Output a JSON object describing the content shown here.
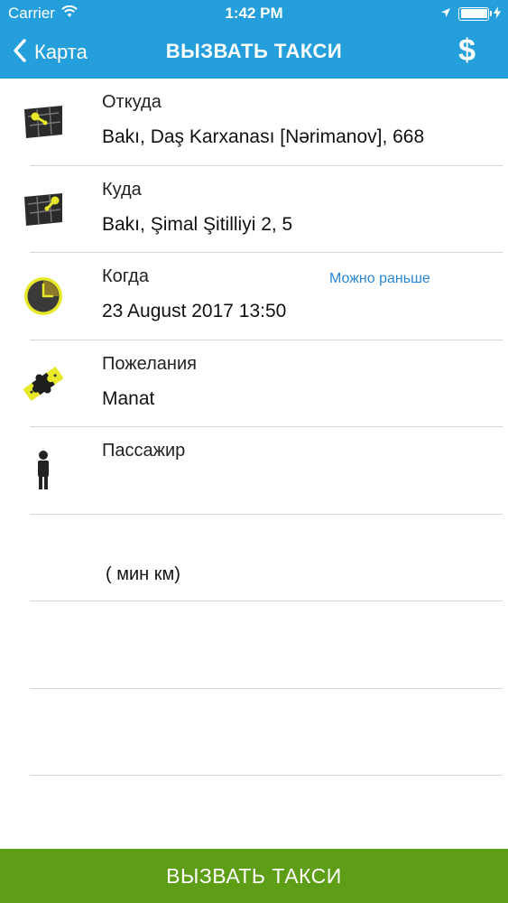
{
  "status_bar": {
    "carrier": "Carrier",
    "time": "1:42 PM"
  },
  "nav": {
    "back_label": "Карта",
    "title": "ВЫЗВАТЬ ТАКСИ",
    "currency_symbol": "$"
  },
  "rows": {
    "from": {
      "label": "Откуда",
      "value": "Bakı, Daş Karxanası [Nərimanov], 668"
    },
    "to": {
      "label": "Куда",
      "value": "Bakı, Şimal Şitilliyi 2, 5"
    },
    "when": {
      "label": "Когда",
      "value": "23 August 2017 13:50",
      "link": "Можно раньше"
    },
    "wishes": {
      "label": "Пожелания",
      "value": "Manat"
    },
    "passenger": {
      "label": "Пассажир",
      "value": ""
    },
    "route": {
      "text": "( мин   км)"
    }
  },
  "footer": {
    "call_button": "ВЫЗВАТЬ ТАКСИ"
  },
  "colors": {
    "header": "#259fdb",
    "call_button": "#5e9e16",
    "link": "#2a86d4",
    "icon_yellow": "#e8e82a"
  },
  "icons": {
    "from": "map-pin-icon",
    "to": "map-pin-icon",
    "when": "clock-icon",
    "wishes": "puzzle-icon",
    "passenger": "person-icon"
  }
}
